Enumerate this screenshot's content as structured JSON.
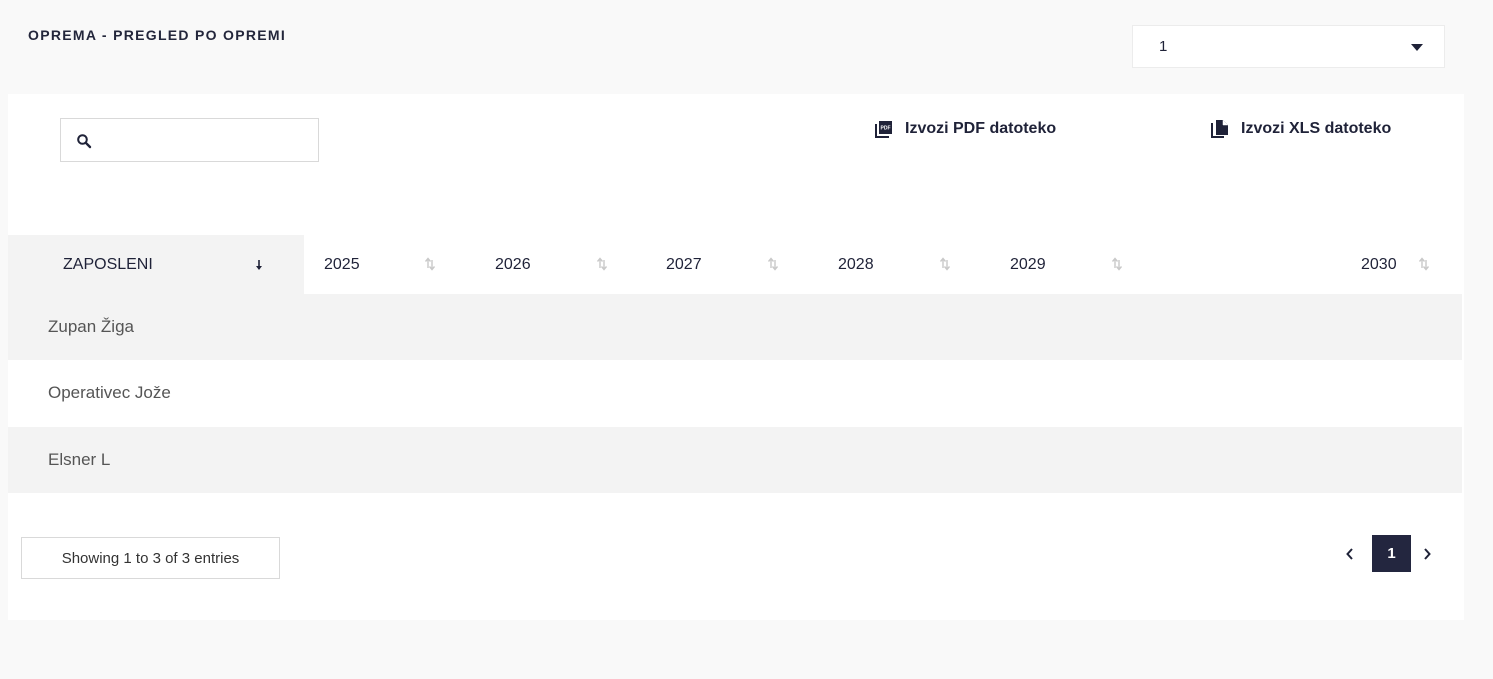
{
  "header": {
    "title": "OPREMA - PREGLED PO OPREMI",
    "select_value": "1"
  },
  "toolbar": {
    "search_placeholder": "",
    "export_pdf_label": "Izvozi PDF datoteko",
    "export_xls_label": "Izvozi XLS datoteko"
  },
  "table": {
    "columns": [
      "ZAPOSLENI",
      "2025",
      "2026",
      "2027",
      "2028",
      "2029",
      "2030"
    ],
    "rows": [
      "Zupan Žiga",
      "Operativec Jože",
      "Elsner L"
    ]
  },
  "footer": {
    "info": "Showing 1 to 3 of 3 entries",
    "current_page": "1",
    "prev_glyph": "‹",
    "next_glyph": "›"
  },
  "colors": {
    "accent": "#23263f",
    "row_alt": "#f3f3f3",
    "background": "#f9f9f9"
  }
}
